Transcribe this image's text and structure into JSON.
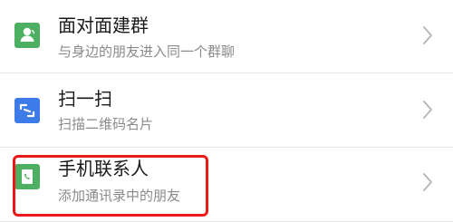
{
  "items": [
    {
      "title": "面对面建群",
      "subtitle": "与身边的朋友进入同一个群聊",
      "icon": "face-to-face-group-icon",
      "icon_color": "#4caf62"
    },
    {
      "title": "扫一扫",
      "subtitle": "扫描二维码名片",
      "icon": "scan-icon",
      "icon_color": "#3d7be8"
    },
    {
      "title": "手机联系人",
      "subtitle": "添加通讯录中的朋友",
      "icon": "phone-contacts-icon",
      "icon_color": "#4caf62"
    }
  ],
  "colors": {
    "highlight": "#ea1a1a",
    "divider": "#e6e6e6",
    "chevron": "#b5b5b5"
  }
}
